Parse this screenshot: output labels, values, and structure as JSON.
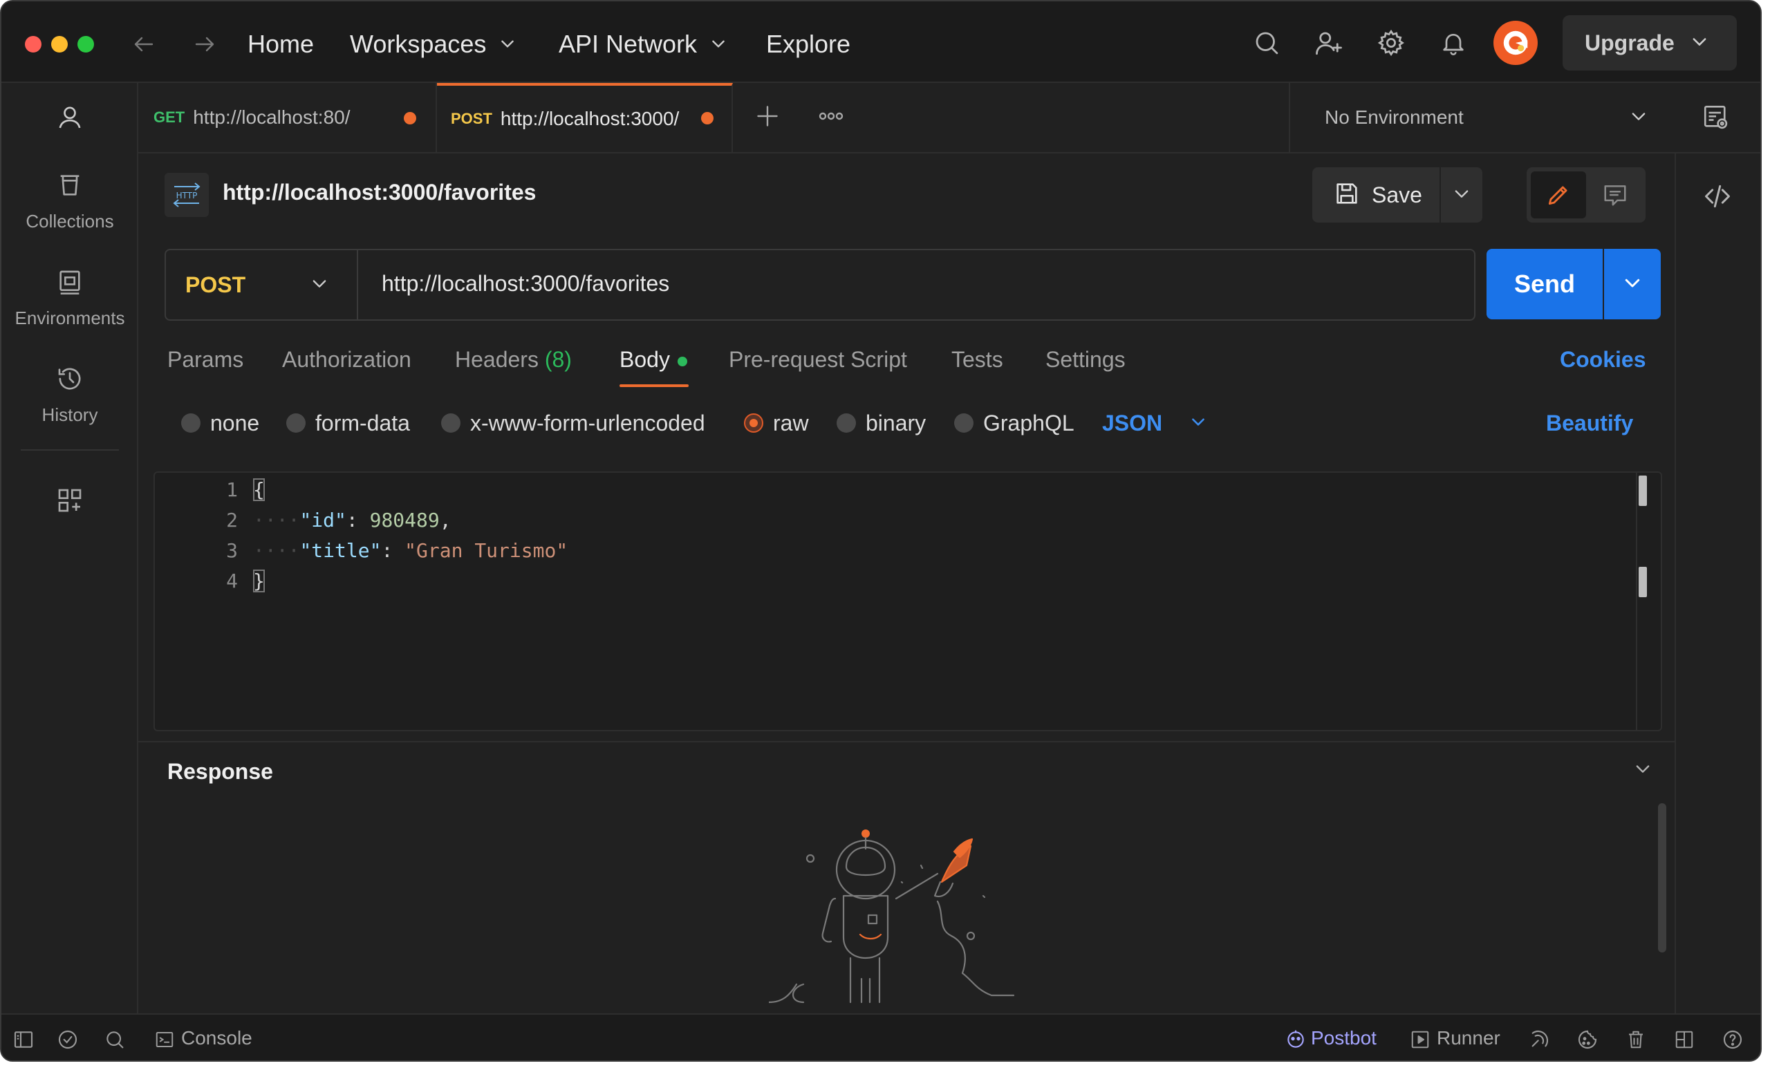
{
  "window": {
    "traffic_lights": [
      "close",
      "minimize",
      "zoom"
    ]
  },
  "topbar": {
    "nav_back_icon": "arrow-left-icon",
    "nav_forward_icon": "arrow-right-icon",
    "home": "Home",
    "workspaces": "Workspaces",
    "api_network": "API Network",
    "explore": "Explore",
    "upgrade": "Upgrade",
    "icons": [
      "search-icon",
      "invite-user-icon",
      "settings-gear-icon",
      "notifications-bell-icon"
    ]
  },
  "sidebar": {
    "items": [
      {
        "label": "Collections",
        "icon": "collections-trash-icon"
      },
      {
        "label": "Environments",
        "icon": "environments-icon"
      },
      {
        "label": "History",
        "icon": "history-clock-icon"
      }
    ]
  },
  "tabs": [
    {
      "method": "GET",
      "method_color": "#3fc06b",
      "url": "http://localhost:80/"
    },
    {
      "method": "POST",
      "method_color": "#f5c84a",
      "url": "http://localhost:3000/"
    }
  ],
  "environment": {
    "selected": "No Environment"
  },
  "request": {
    "title": "http://localhost:3000/favorites",
    "save": "Save",
    "method": "POST",
    "url": "http://localhost:3000/favorites",
    "send": "Send",
    "tabs": {
      "params": "Params",
      "authorization": "Authorization",
      "headers": "Headers",
      "headers_count": "(8)",
      "body": "Body",
      "prerequest": "Pre-request Script",
      "tests": "Tests",
      "settings": "Settings"
    },
    "cookies": "Cookies",
    "body_options": [
      "none",
      "form-data",
      "x-www-form-urlencoded",
      "raw",
      "binary",
      "GraphQL"
    ],
    "body_selected": "raw",
    "body_format": "JSON",
    "beautify": "Beautify",
    "code_lines": [
      "1",
      "2",
      "3",
      "4"
    ],
    "code": {
      "open": "{",
      "id_key": "\"id\"",
      "id_value": "980489",
      "title_key": "\"title\"",
      "title_value": "\"Gran Turismo\"",
      "close": "}"
    }
  },
  "response": {
    "title": "Response"
  },
  "statusbar": {
    "console": "Console",
    "postbot": "Postbot",
    "runner": "Runner"
  },
  "colors": {
    "accent_orange": "#ef6c2f",
    "send_blue": "#1a73e8",
    "link_blue": "#3d8ef2",
    "post_yellow": "#f5c84a",
    "get_green": "#3fc06b"
  }
}
